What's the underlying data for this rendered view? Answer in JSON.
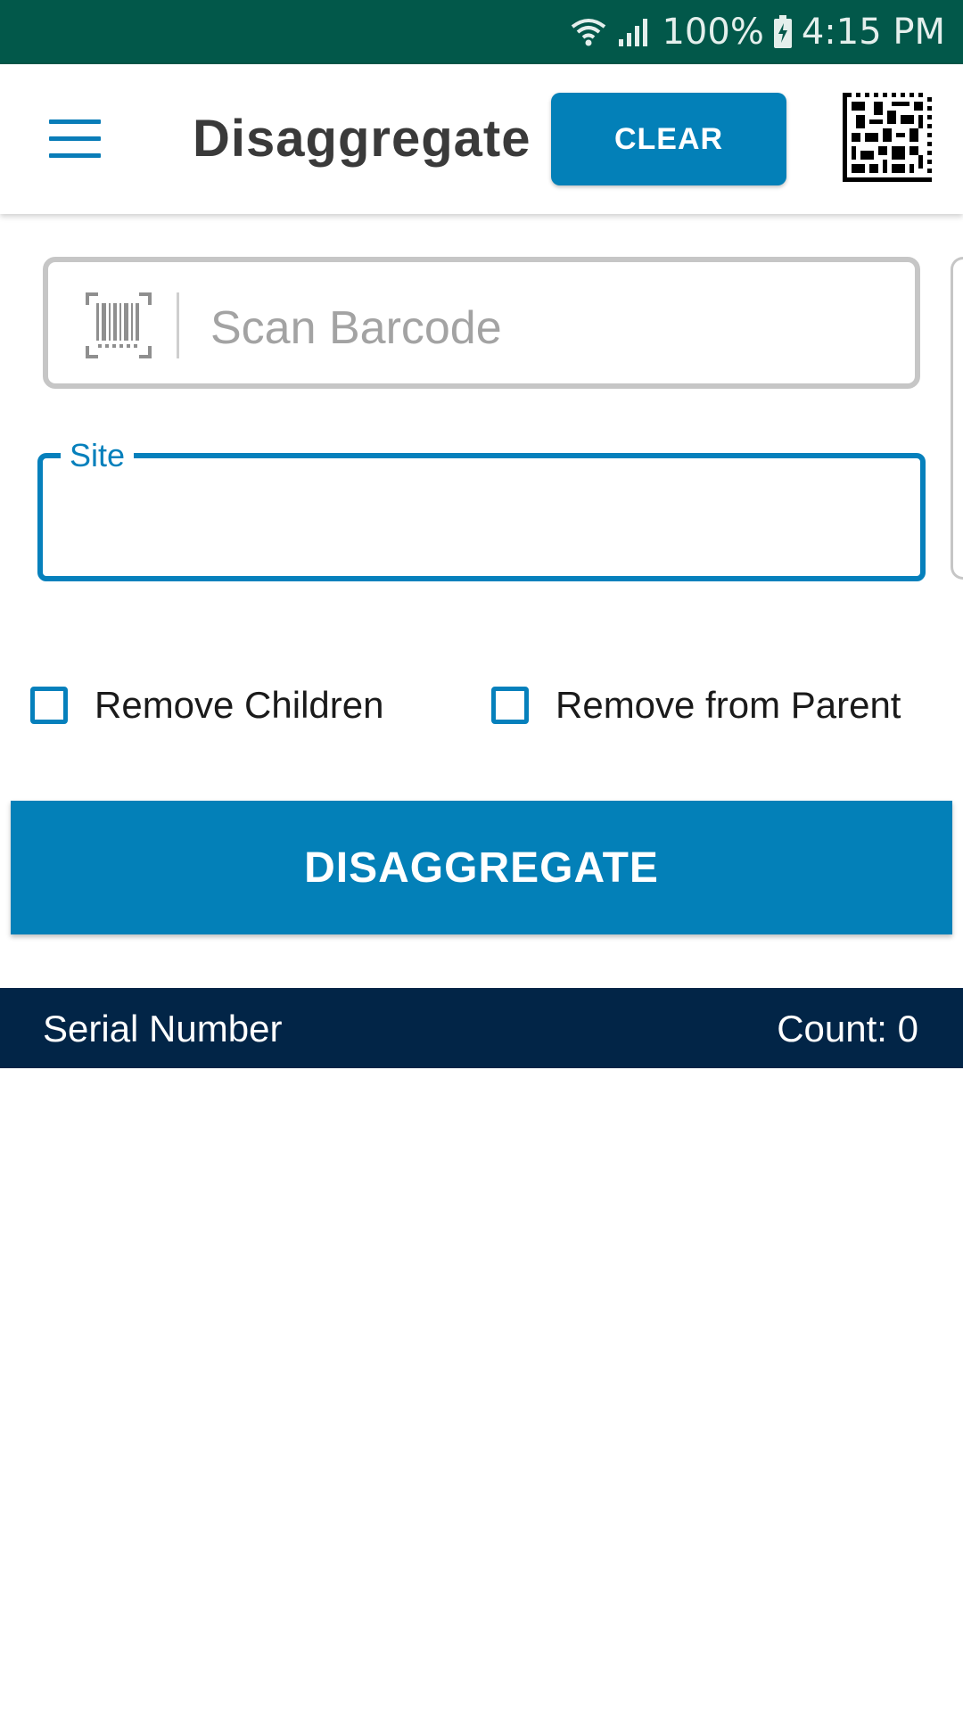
{
  "status_bar": {
    "battery": "100%",
    "time": "4:15 PM",
    "icons": [
      "wifi-icon",
      "signal-icon",
      "battery-charging-icon"
    ]
  },
  "app_bar": {
    "title": "Disaggregate",
    "clear_label": "CLEAR",
    "menu_icon": "hamburger-menu-icon",
    "scan_icon": "datamatrix-code-icon"
  },
  "form": {
    "scan_placeholder": "Scan Barcode",
    "scan_value": "",
    "site_label": "Site",
    "site_value": "",
    "checkboxes": [
      {
        "label": "Remove Children",
        "checked": false
      },
      {
        "label": "Remove from Parent",
        "checked": false
      }
    ],
    "submit_label": "DISAGGREGATE"
  },
  "list": {
    "column_serial": "Serial Number",
    "count_text": "Count: 0"
  },
  "colors": {
    "status_bar": "#02584a",
    "accent": "#0380b8",
    "list_header": "#022547"
  }
}
